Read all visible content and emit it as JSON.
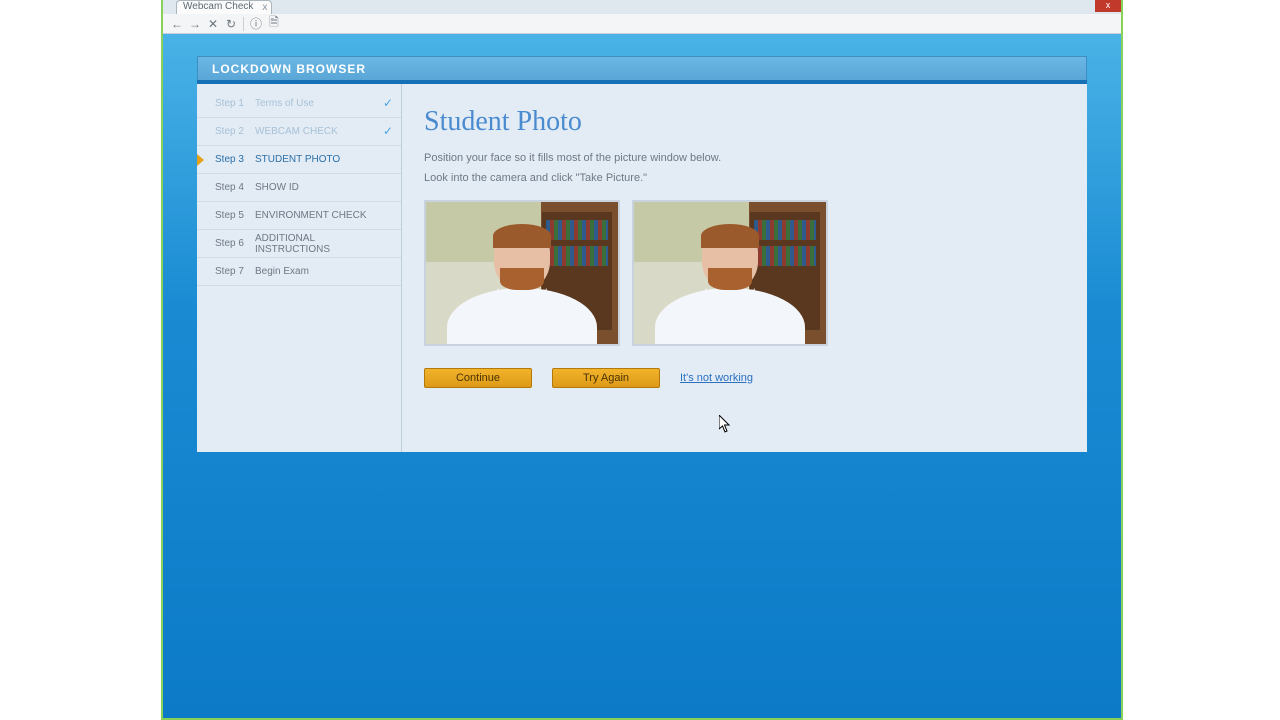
{
  "browser": {
    "tab_title": "Webcam Check",
    "close_glyph": "x"
  },
  "toolbar": {
    "back": "←",
    "forward": "→",
    "stop": "✕",
    "reload": "↻",
    "info": "ⓘ",
    "page": "🗎"
  },
  "app": {
    "header_title": "LOCKDOWN BROWSER"
  },
  "sidebar": {
    "steps": [
      {
        "num": "Step 1",
        "label": "Terms of Use"
      },
      {
        "num": "Step 2",
        "label": "WEBCAM CHECK"
      },
      {
        "num": "Step 3",
        "label": "STUDENT PHOTO"
      },
      {
        "num": "Step 4",
        "label": "SHOW ID"
      },
      {
        "num": "Step 5",
        "label": "ENVIRONMENT CHECK"
      },
      {
        "num": "Step 6",
        "label": "ADDITIONAL INSTRUCTIONS"
      },
      {
        "num": "Step 7",
        "label": "Begin Exam"
      }
    ],
    "check_glyph": "✓"
  },
  "main": {
    "title": "Student Photo",
    "instruction1": "Position your face so it fills most of the picture window below.",
    "instruction2": "Look into the camera and click \"Take Picture.\"",
    "continue_label": "Continue",
    "try_again_label": "Try Again",
    "not_working_label": "It's not working"
  }
}
